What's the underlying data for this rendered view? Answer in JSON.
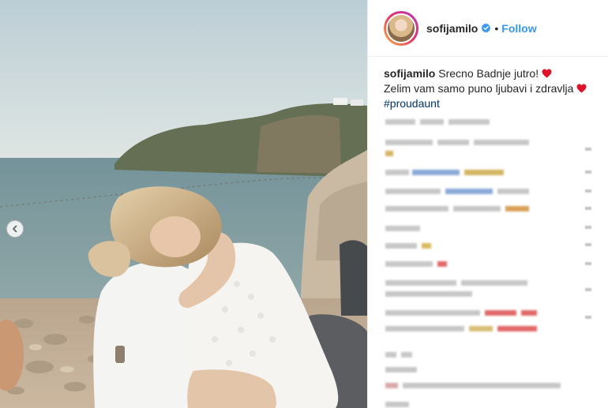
{
  "profile": {
    "username": "sofijamilo",
    "separator": "•",
    "follow_label": "Follow"
  },
  "caption": {
    "username": "sofijamilo",
    "line1": "Srecno Badnje jutro!",
    "line2": "Zelim vam samo puno ljubavi i zdravlja",
    "hashtag": "#proudaunt"
  },
  "icons": {
    "verified": "verified-badge-icon",
    "heart": "red-heart-emoji",
    "carousel_prev": "chevron-left-icon"
  },
  "colors": {
    "follow": "#3897f0",
    "verified": "#3897f0",
    "hashtag": "#003569",
    "text": "#262626",
    "heart": "#e0132b"
  }
}
